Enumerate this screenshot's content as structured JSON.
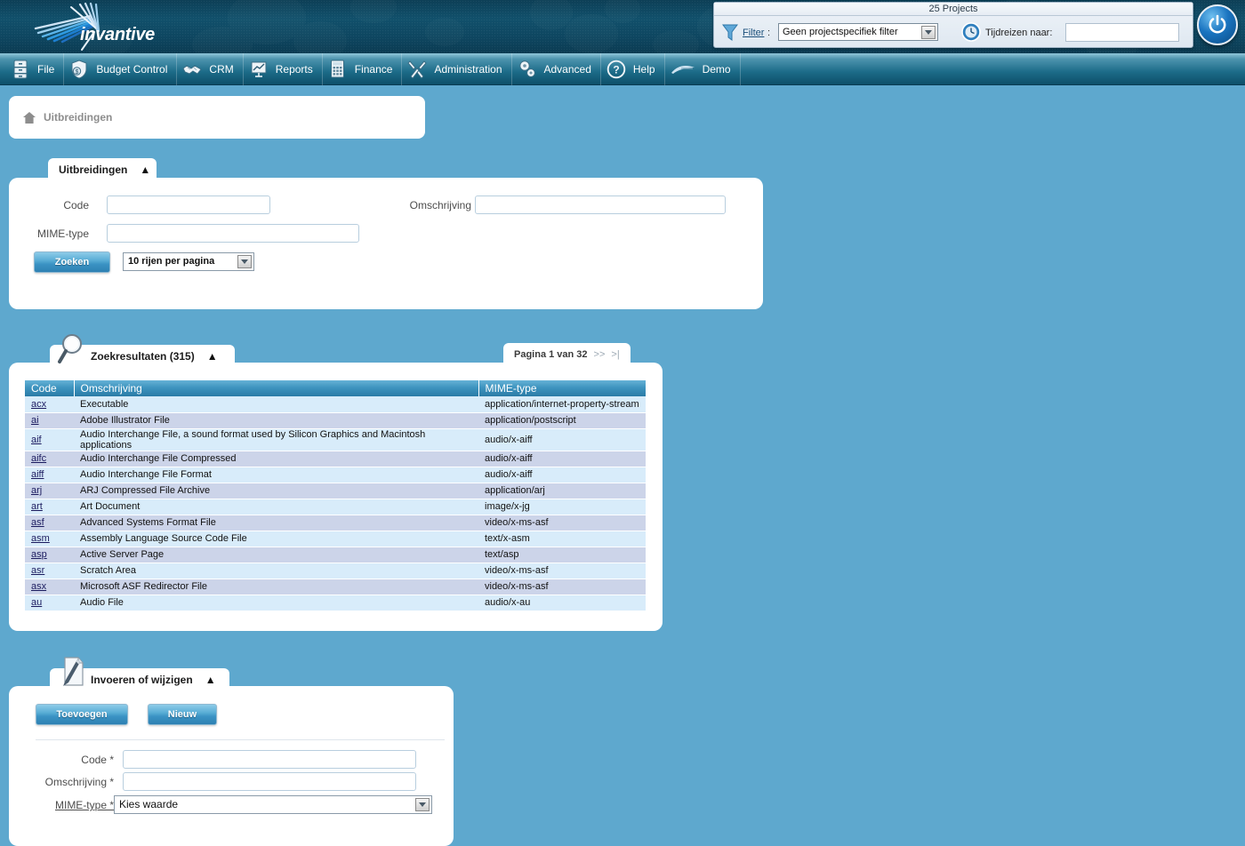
{
  "brand": {
    "logo_text": "invantive"
  },
  "topbar": {
    "projects_title": "25 Projects",
    "filter_label": "Filter",
    "filter_colon": ":",
    "filter_value": "Geen projectspecifiek filter",
    "timetravel_label": "Tijdreizen naar:",
    "timetravel_value": "",
    "power_title": "Power"
  },
  "menu": [
    {
      "label": "File",
      "icon": "cabinet-icon"
    },
    {
      "label": "Budget Control",
      "icon": "money-shield-icon"
    },
    {
      "label": "CRM",
      "icon": "handshake-icon"
    },
    {
      "label": "Reports",
      "icon": "presentation-chart-icon"
    },
    {
      "label": "Finance",
      "icon": "calculator-icon"
    },
    {
      "label": "Administration",
      "icon": "tools-icon"
    },
    {
      "label": "Advanced",
      "icon": "gears-icon"
    },
    {
      "label": "Help",
      "icon": "question-circle-icon"
    },
    {
      "label": "Demo",
      "icon": "swoosh-icon"
    }
  ],
  "breadcrumb": {
    "home_icon": "home-icon",
    "text": "Uitbreidingen"
  },
  "search_panel": {
    "tab_title": "Uitbreidingen",
    "collapse_icon": "«",
    "code_label": "Code",
    "code_value": "",
    "omschrijving_label": "Omschrijving",
    "omschrijving_value": "",
    "mime_label": "MIME-type",
    "mime_value": "",
    "search_button": "Zoeken",
    "rows_per_page": "10 rijen per pagina"
  },
  "results_panel": {
    "tab_title": "Zoekresultaten (315)",
    "collapse_icon": "«",
    "pager_text": "Pagina 1 van 32",
    "pager_next": ">>",
    "pager_last": ">|",
    "columns": [
      "Code",
      "Omschrijving",
      "MIME-type"
    ],
    "rows": [
      {
        "code": "acx",
        "omschrijving": "Executable",
        "mime": "application/internet-property-stream"
      },
      {
        "code": "ai",
        "omschrijving": "Adobe Illustrator File",
        "mime": "application/postscript"
      },
      {
        "code": "aif",
        "omschrijving": "Audio Interchange File, a sound format used by Silicon Graphics and Macintosh applications",
        "mime": "audio/x-aiff"
      },
      {
        "code": "aifc",
        "omschrijving": "Audio Interchange File Compressed",
        "mime": "audio/x-aiff"
      },
      {
        "code": "aiff",
        "omschrijving": "Audio Interchange File Format",
        "mime": "audio/x-aiff"
      },
      {
        "code": "arj",
        "omschrijving": "ARJ Compressed File Archive",
        "mime": "application/arj"
      },
      {
        "code": "art",
        "omschrijving": "Art Document",
        "mime": "image/x-jg"
      },
      {
        "code": "asf",
        "omschrijving": "Advanced Systems Format File",
        "mime": "video/x-ms-asf"
      },
      {
        "code": "asm",
        "omschrijving": "Assembly Language Source Code File",
        "mime": "text/x-asm"
      },
      {
        "code": "asp",
        "omschrijving": "Active Server Page",
        "mime": "text/asp"
      },
      {
        "code": "asr",
        "omschrijving": "Scratch Area",
        "mime": "video/x-ms-asf"
      },
      {
        "code": "asx",
        "omschrijving": "Microsoft ASF Redirector File",
        "mime": "video/x-ms-asf"
      },
      {
        "code": "au",
        "omschrijving": "Audio File",
        "mime": "audio/x-au"
      }
    ]
  },
  "edit_panel": {
    "tab_title": "Invoeren of wijzigen",
    "collapse_icon": "«",
    "add_button": "Toevoegen",
    "new_button": "Nieuw",
    "code_label": "Code *",
    "code_value": "",
    "omschrijving_label": "Omschrijving *",
    "omschrijving_value": "",
    "mime_label": "MIME-type *",
    "mime_value": "Kies waarde"
  },
  "colors": {
    "page_background": "#5ea8ce",
    "header_dark": "#0d3f56",
    "accent_blue": "#3e94bf",
    "row_odd": "#d8ecfa",
    "row_even": "#ccd4e9",
    "link": "#1a1a5e"
  }
}
